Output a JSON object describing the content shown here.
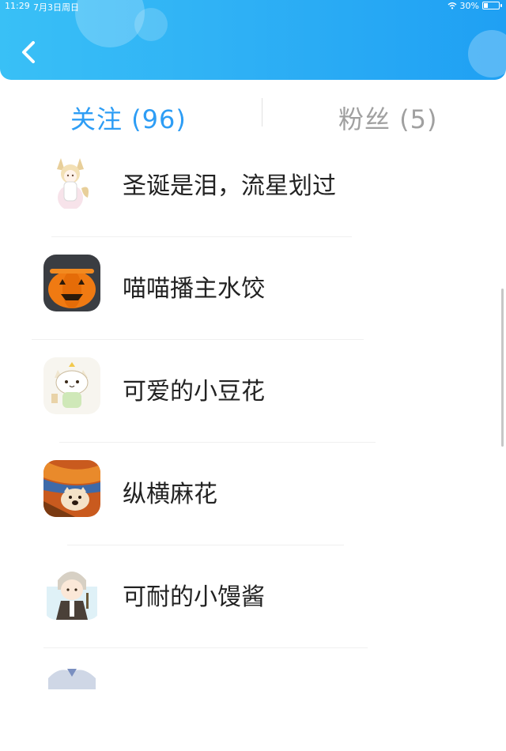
{
  "status_bar": {
    "time": "11:29",
    "date": "7月3日周日",
    "battery": "30%",
    "battery_level": 0.3
  },
  "header": {
    "back_icon": "chevron-left-icon",
    "background_color": "#2fb1f5"
  },
  "tabs": [
    {
      "label": "关注 (96)",
      "active": true,
      "color": "#2d9df5"
    },
    {
      "label": "粉丝 (5)",
      "active": false,
      "color": "#a0a0a0"
    }
  ],
  "following": [
    {
      "name": "圣诞是泪，流星划过",
      "avatar": "fox-girl-avatar"
    },
    {
      "name": "喵喵播主水饺",
      "avatar": "pumpkin-avatar"
    },
    {
      "name": "可爱的小豆花",
      "avatar": "cat-avatar"
    },
    {
      "name": "纵横麻花",
      "avatar": "painting-cat-avatar"
    },
    {
      "name": "可耐的小馒酱",
      "avatar": "boy-avatar"
    },
    {
      "name": "",
      "avatar": "partial-avatar"
    }
  ]
}
